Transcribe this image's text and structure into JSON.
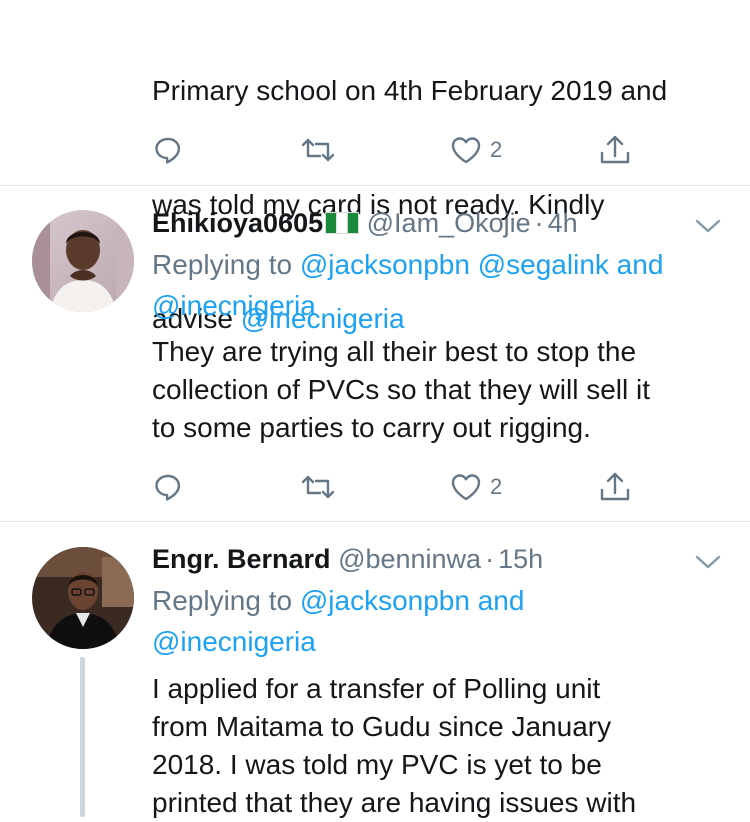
{
  "tweet_top": {
    "text_line1": "Primary school on 4th February 2019 and",
    "text_line2": "was told my card is not ready. Kindly",
    "text_line3_prefix": "advise ",
    "text_line3_mention": "@inecnigeria",
    "like_count": "2"
  },
  "tweet_okojie": {
    "name": "Ehikioya0605",
    "handle": "@Iam_Okojie",
    "separator": "·",
    "time": "4h",
    "replying_prefix": "Replying to ",
    "replying_mention1": "@jacksonpbn",
    "replying_mention2": "@segalink",
    "replying_and": " and",
    "replying_mention3": "@inecnigeria",
    "text": "They are trying all their best to stop the\ncollection of PVCs so that they will sell it\nto some parties to carry out rigging.",
    "like_count": "2"
  },
  "tweet_bernard": {
    "name": "Engr. Bernard",
    "handle": "@benninwa",
    "separator": "·",
    "time": "15h",
    "replying_prefix": "Replying to ",
    "replying_mention1": "@jacksonpbn",
    "replying_and": " and",
    "replying_mention2": "@inecnigeria",
    "text": "I applied for a transfer of Polling unit\nfrom Maitama to Gudu since January\n2018. I was told my PVC is yet to be\nprinted that they are having issues with"
  },
  "icons": {
    "reply": "reply-icon",
    "retweet": "retweet-icon",
    "like": "heart-icon",
    "share": "share-icon",
    "caret": "chevron-down-icon",
    "flag": "nigeria-flag-icon"
  },
  "colors": {
    "link": "#1da1f2",
    "secondary_text": "#657786",
    "separator": "#e1e8ed",
    "thread_line": "#ccd6dd"
  }
}
